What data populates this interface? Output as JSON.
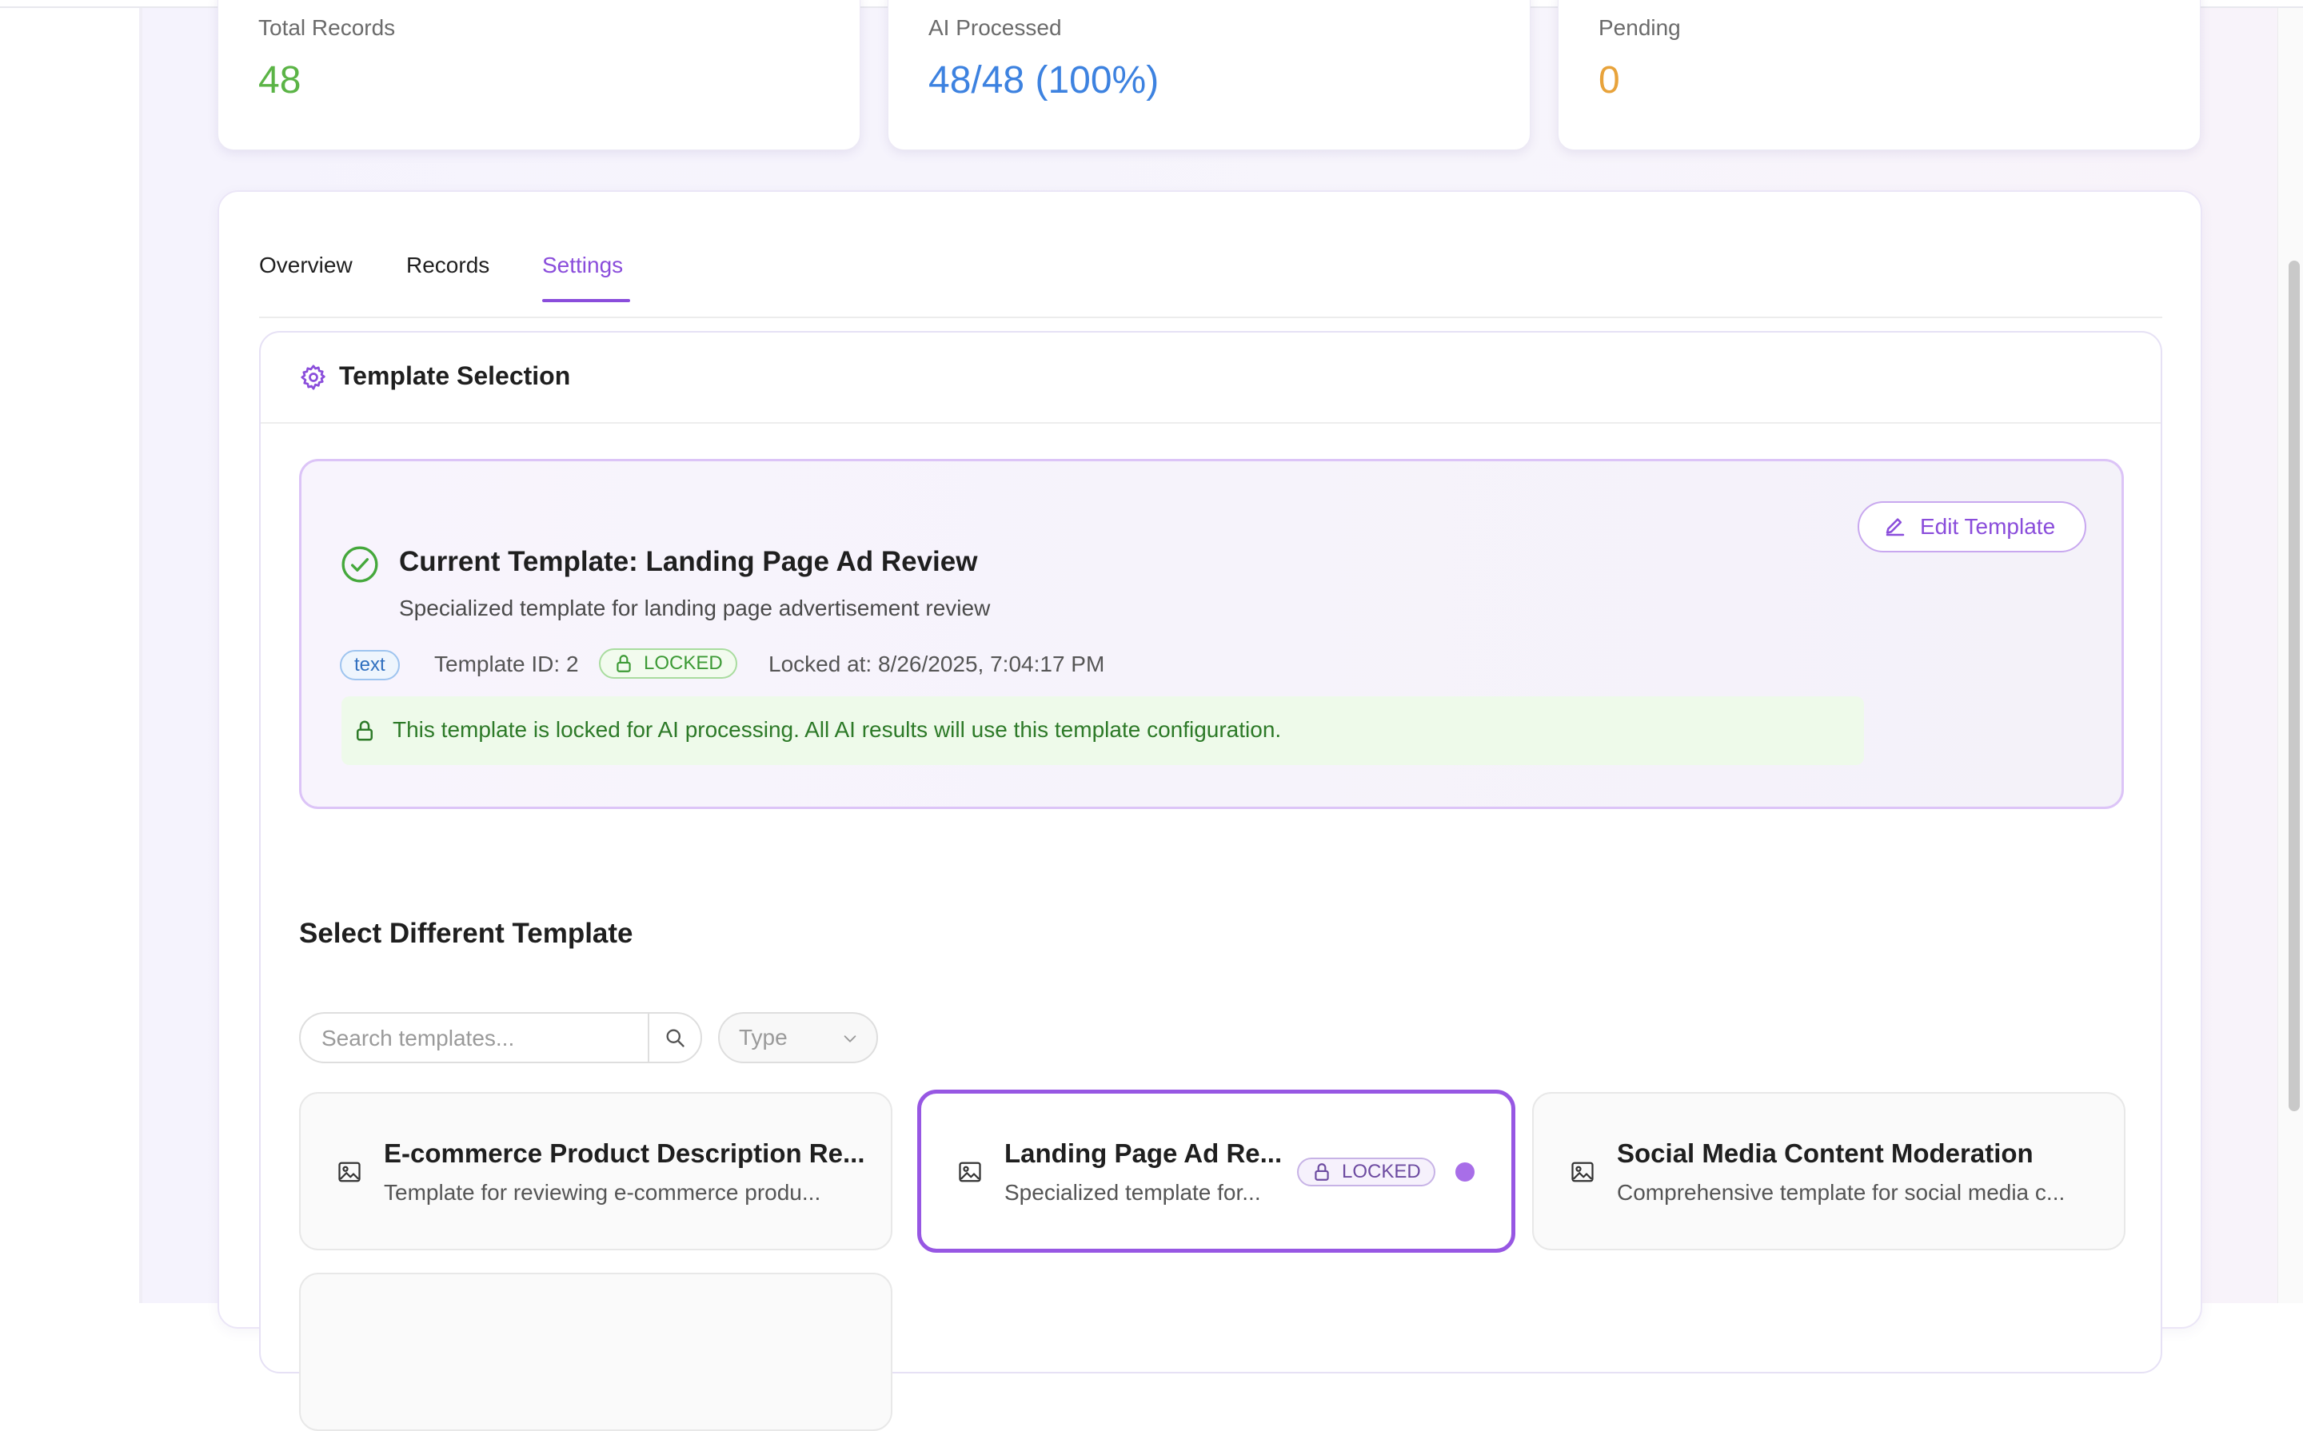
{
  "stats": [
    {
      "label": "Total Records",
      "value": "48",
      "color": "#5bb446"
    },
    {
      "label": "AI Processed",
      "value": "48/48 (100%)",
      "color": "#3d82e0"
    },
    {
      "label": "Pending",
      "value": "0",
      "color": "#e8a33b"
    }
  ],
  "tabs": [
    {
      "label": "Overview",
      "active": false
    },
    {
      "label": "Records",
      "active": false
    },
    {
      "label": "Settings",
      "active": true
    }
  ],
  "template_section": {
    "title": "Template Selection",
    "icon": "gear-icon",
    "current": {
      "title": "Current Template: Landing Page Ad Review",
      "description": "Specialized template for landing page advertisement review",
      "type_badge": "text",
      "template_id": "Template ID: 2",
      "locked_badge": "LOCKED",
      "locked_at": "Locked at: 8/26/2025, 7:04:17 PM",
      "lock_note": "This template is locked for AI processing. All AI results will use this template configuration.",
      "edit_button": "Edit Template"
    },
    "select": {
      "title": "Select Different Template",
      "search_placeholder": "Search templates...",
      "type_filter_placeholder": "Type",
      "cards": [
        {
          "name": "E-commerce Product Description Re...",
          "description": "Template for reviewing e-commerce produ...",
          "selected": false
        },
        {
          "name": "Landing Page Ad Re...",
          "description": "Specialized template for...",
          "selected": true,
          "badge": "LOCKED"
        },
        {
          "name": "Social Media Content Moderation",
          "description": "Comprehensive template for social media c...",
          "selected": false
        }
      ]
    }
  },
  "colors": {
    "accent": "#8a4ddb",
    "success": "#3c9a35",
    "info": "#2f6fbf"
  }
}
